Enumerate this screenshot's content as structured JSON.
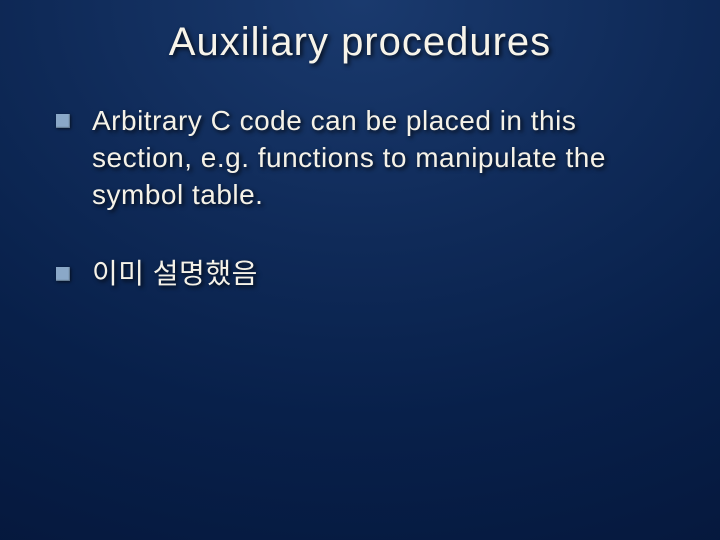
{
  "slide": {
    "title": "Auxiliary procedures",
    "bullets": [
      {
        "text": "Arbitrary C code can be placed in this section, e.g. functions to manipulate the symbol table."
      },
      {
        "text": "이미 설명했음"
      }
    ]
  }
}
